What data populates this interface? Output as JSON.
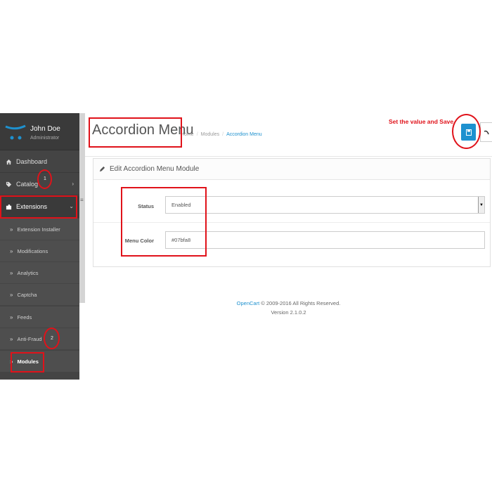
{
  "profile": {
    "name": "John Doe",
    "role": "Administrator"
  },
  "sidebar": {
    "items": [
      {
        "label": "Dashboard",
        "icon": "home-icon"
      },
      {
        "label": "Catalog",
        "icon": "tag-icon"
      },
      {
        "label": "Extensions",
        "icon": "puzzle-icon"
      }
    ],
    "subitems": [
      {
        "label": "Extension Installer"
      },
      {
        "label": "Modifications"
      },
      {
        "label": "Analytics"
      },
      {
        "label": "Captcha"
      },
      {
        "label": "Feeds"
      },
      {
        "label": "Anti-Fraud"
      },
      {
        "label": "Modules"
      }
    ],
    "annotations": [
      "1",
      "2"
    ]
  },
  "header": {
    "title": "Accordion Menu",
    "breadcrumb": [
      "Home",
      "Modules",
      "Accordion Menu"
    ],
    "instruction": "Set the value and Save"
  },
  "panel": {
    "title": "Edit Accordion Menu Module",
    "status_label": "Status",
    "status_value": "Enabled",
    "color_label": "Menu Color",
    "color_value": "#07bfa8"
  },
  "footer": {
    "brand": "OpenCart",
    "copyright": " © 2009-2016 All Rights Reserved.",
    "version": "Version 2.1.0.2"
  },
  "colors": {
    "accent": "#1e91cf",
    "sidebar": "#444444",
    "highlight": "#e0121a"
  }
}
